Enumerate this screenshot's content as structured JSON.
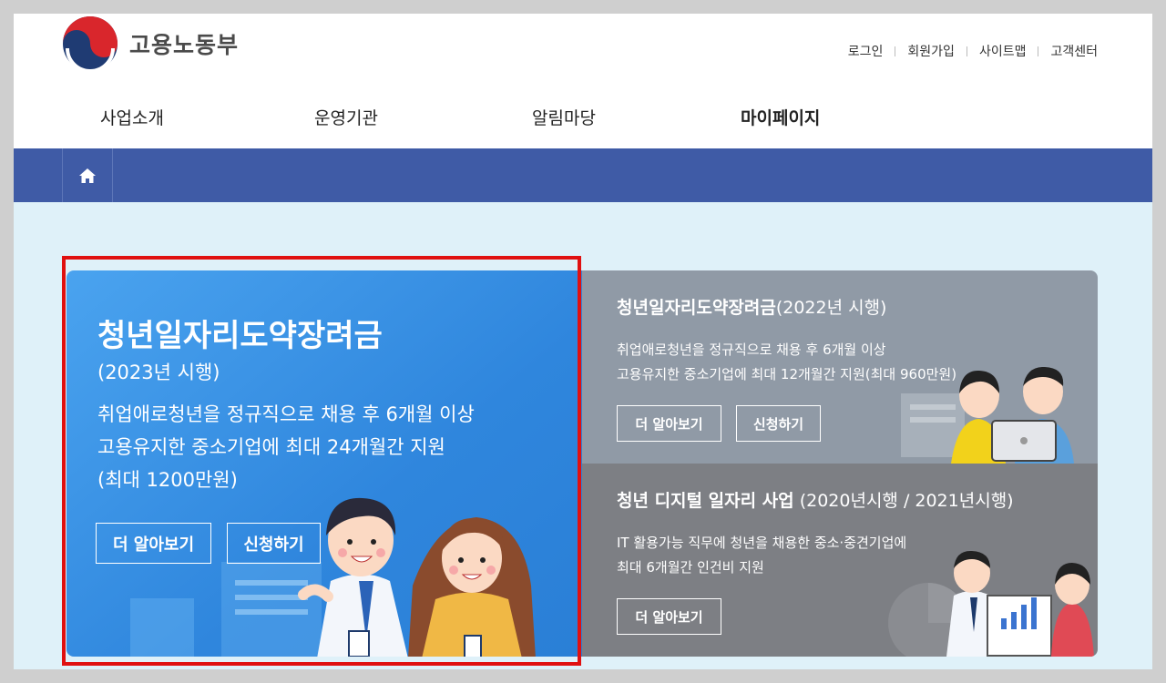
{
  "header": {
    "logo_text": "고용노동부",
    "util_links": [
      "로그인",
      "회원가입",
      "사이트맵",
      "고객센터"
    ],
    "nav": [
      "사업소개",
      "운영기관",
      "알림마당",
      "마이페이지"
    ]
  },
  "hero": {
    "title": "청년일자리도약장려금",
    "subtitle": "(2023년 시행)",
    "desc_line1": "취업애로청년을 정규직으로 채용 후 6개월 이상",
    "desc_line2": "고용유지한 중소기업에 최대 24개월간 지원",
    "desc_line3": "(최대 1200만원)",
    "more_label": "더 알아보기",
    "apply_label": "신청하기"
  },
  "card_2022": {
    "title_bold": "청년일자리도약장려금",
    "title_rest": "(2022년 시행)",
    "desc_line1": "취업애로청년을 정규직으로 채용 후 6개월 이상",
    "desc_line2": "고용유지한 중소기업에 최대 12개월간 지원(최대 960만원)",
    "more_label": "더 알아보기",
    "apply_label": "신청하기"
  },
  "card_digital": {
    "title_bold": "청년 디지털 일자리 사업",
    "title_rest": " (2020년시행 / 2021년시행)",
    "desc_line1": "IT 활용가능 직무에 청년을 채용한 중소·중견기업에",
    "desc_line2": "최대 6개월간 인건비 지원",
    "more_label": "더 알아보기"
  },
  "colors": {
    "nav_bar": "#3f5ba6",
    "hero_blue": "#2f86dd",
    "card_gray": "#909aa6",
    "card_dark": "#7d7f84",
    "highlight": "#e01010"
  }
}
